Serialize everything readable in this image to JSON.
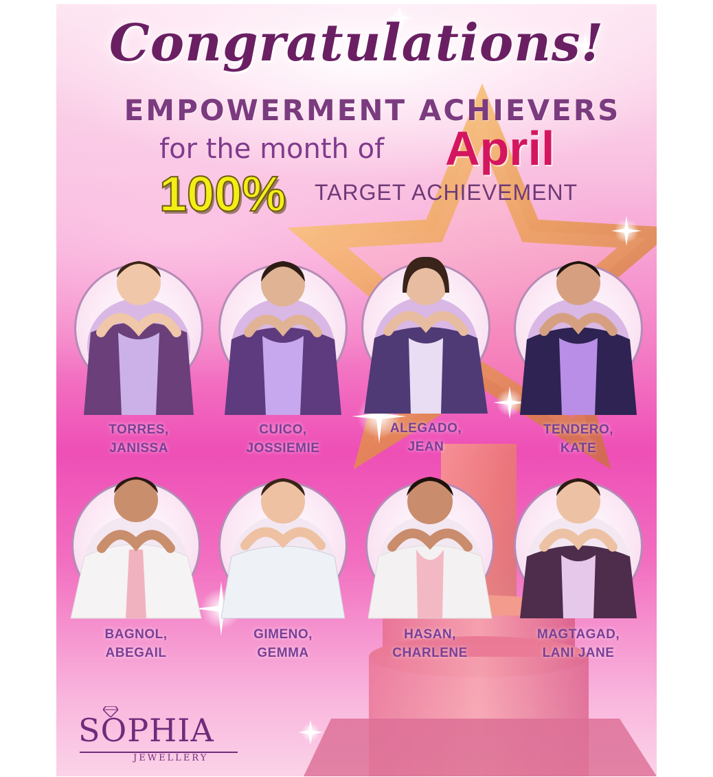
{
  "header": {
    "title": "Congratulations!",
    "subtitle": "EMPOWERMENT ACHIEVERS",
    "month_prefix": "for the month of",
    "month": "April",
    "percent": "100%",
    "target_label": "TARGET ACHIEVEMENT"
  },
  "achievers": [
    {
      "line1": "TORRES,",
      "line2": "JANISSA"
    },
    {
      "line1": "CUICO,",
      "line2": "JOSSIEMIE"
    },
    {
      "line1": "ALEGADO,",
      "line2": "JEAN"
    },
    {
      "line1": "TENDERO,",
      "line2": "KATE"
    },
    {
      "line1": "BAGNOL,",
      "line2": "ABEGAIL"
    },
    {
      "line1": "GIMENO,",
      "line2": "GEMMA"
    },
    {
      "line1": "HASAN,",
      "line2": "CHARLENE"
    },
    {
      "line1": "MAGTAGAD,",
      "line2": "LANI JANE"
    }
  ],
  "logo": {
    "brand": "SOPHIA",
    "sub": "JEWELLERY"
  },
  "colors": {
    "title": "#6a1f63",
    "name_text": "#7a3f96",
    "month": "#d4165f",
    "percent": "#f5ee16",
    "background_pink": "#ee4fb6"
  }
}
